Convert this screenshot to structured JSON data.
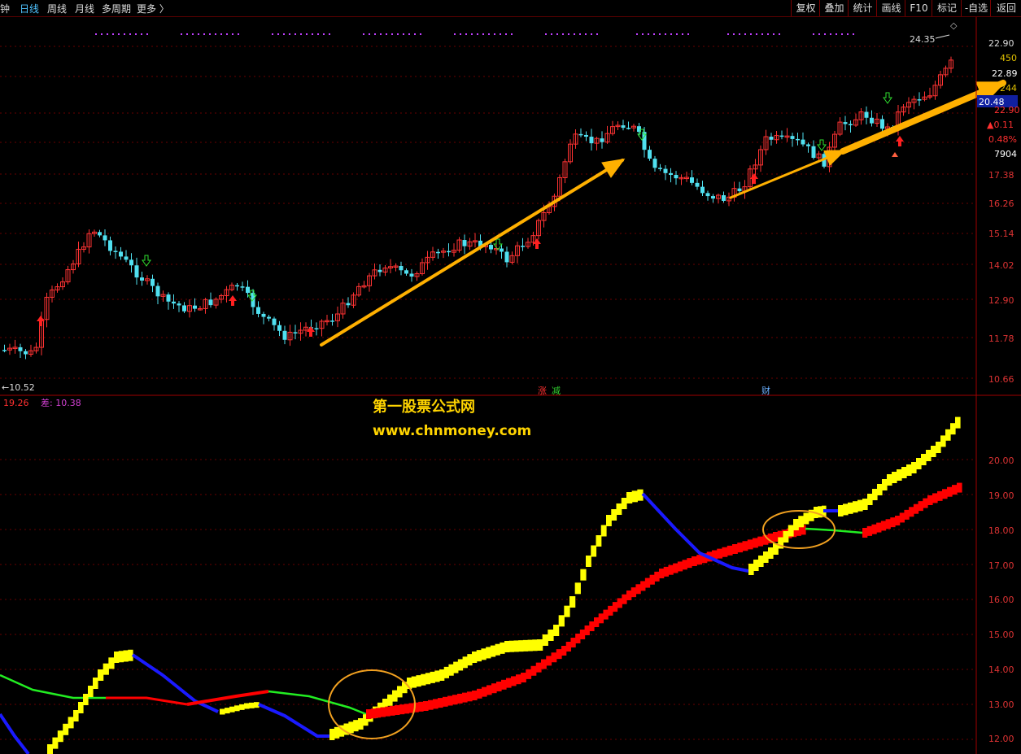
{
  "toolbar": {
    "periods": [
      "钟",
      "日线",
      "周线",
      "月线",
      "多周期",
      "更多 〉"
    ],
    "active_period": "日线",
    "buttons": [
      "复权",
      "叠加",
      "统计",
      "画线",
      "F10",
      "标记",
      "-自选",
      "返回"
    ]
  },
  "price_panel": {
    "y_ticks": [
      "22.90",
      "17.38",
      "16.26",
      "15.14",
      "14.02",
      "12.90",
      "11.78",
      "10.66"
    ],
    "info_values": [
      {
        "text": "450",
        "color": "#e0c000"
      },
      {
        "text": "22.89",
        "color": "#ffffff"
      },
      {
        "text": "244",
        "color": "#e0c000"
      },
      {
        "text": "20.48",
        "color": "#ffffff",
        "bg": "#1020a0"
      },
      {
        "text": "22.90",
        "color": "#ff3030"
      },
      {
        "text": "▲0.11",
        "color": "#ff3030"
      },
      {
        "text": "0.48%",
        "color": "#ff3030"
      },
      {
        "text": "7904",
        "color": "#ffffff"
      }
    ],
    "high_label": "24.35",
    "low_label": "←10.52",
    "markers": [
      {
        "text": "涨",
        "color": "#ff3030"
      },
      {
        "text": "减",
        "color": "#30d030"
      },
      {
        "text": "财",
        "color": "#6ab0ff"
      }
    ]
  },
  "indicator_panel": {
    "legend": [
      {
        "text": "19.26",
        "color": "#ff3030"
      },
      {
        "text": "差: 10.38",
        "color": "#d040d0"
      }
    ],
    "y_ticks": [
      "20.00",
      "19.00",
      "18.00",
      "17.00",
      "16.00",
      "15.00",
      "14.00",
      "13.00",
      "12.00"
    ]
  },
  "watermark": {
    "line1": "第一股票公式网",
    "line2": "www.chnmoney.com"
  },
  "colors": {
    "up": "#ff3333",
    "down": "#50e0f0",
    "grid": "#6a0000",
    "yellow": "#ffff00",
    "red_line": "#ff0000",
    "blue_line": "#1a1aff",
    "green_line": "#22ee22",
    "arrow": "#ffb000",
    "circle": "#f0a020"
  }
}
